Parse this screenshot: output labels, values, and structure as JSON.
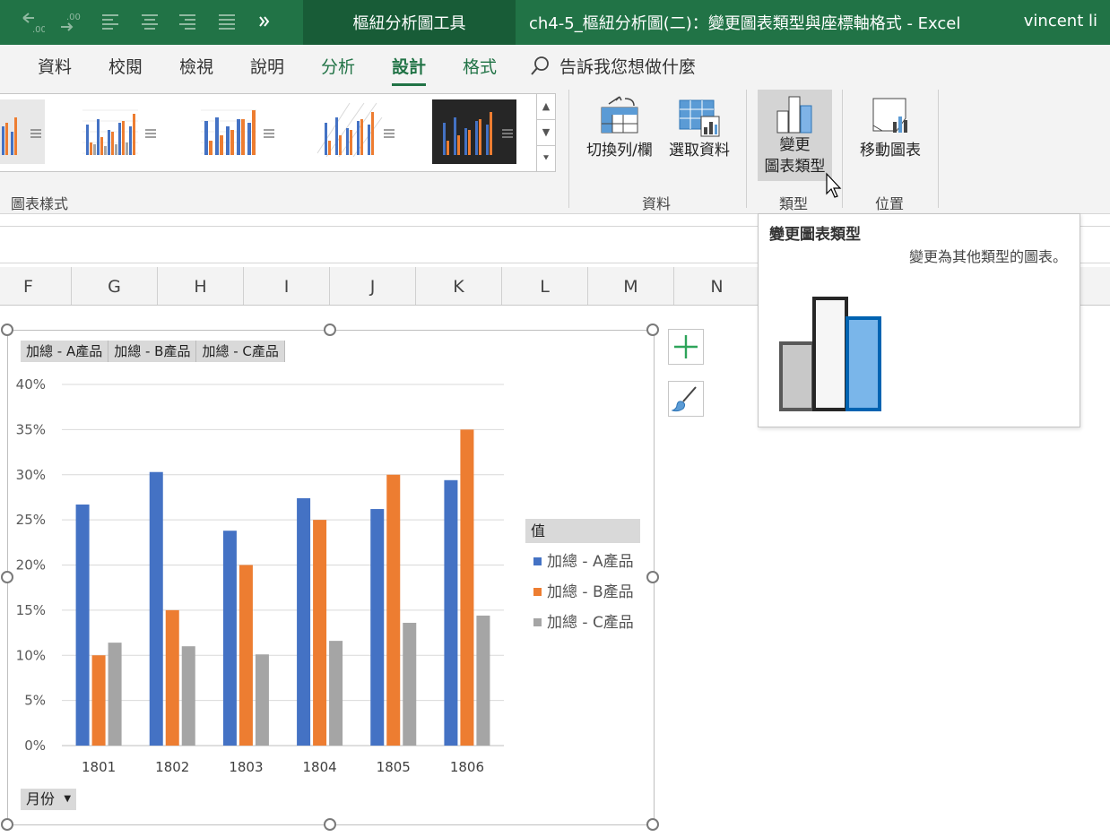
{
  "titlebar": {
    "qat_icons": [
      "undo-icon",
      "redo-icon",
      "align-left-icon",
      "align-center-icon",
      "align-right-icon",
      "justify-icon",
      "more-icon"
    ],
    "context_tab": "樞紐分析圖工具",
    "document_title": "ch4-5_樞紐分析圖(二)：變更圖表類型與座標軸格式  -  Excel",
    "user": "vincent li"
  },
  "ribbon_tabs": {
    "partial": "：",
    "data": "資料",
    "review": "校閱",
    "view": "檢視",
    "help": "說明",
    "analyze": "分析",
    "design": "設計",
    "format": "格式",
    "tell_me": "告訴我您想做什麼"
  },
  "ribbon": {
    "chart_styles_label": "圖表樣式",
    "switch_row_col": "切換列/欄",
    "select_data": "選取資料",
    "data_group_label": "資料",
    "change_type_line1": "變更",
    "change_type_line2": "圖表類型",
    "type_group_label": "類型",
    "move_chart": "移動圖表",
    "location_group_label": "位置"
  },
  "columns": [
    "F",
    "G",
    "H",
    "I",
    "J",
    "K",
    "L",
    "M",
    "N"
  ],
  "tooltip": {
    "title": "變更圖表類型",
    "description": "變更為其他類型的圖表。"
  },
  "chart": {
    "field_buttons": [
      "加總 - A產品",
      "加總 - B產品",
      "加總 - C產品"
    ],
    "legend_title": "值",
    "axis_field_button": "月份"
  },
  "colors": {
    "excel_green": "#217346",
    "series_a": "#4472c4",
    "series_b": "#ed7d31",
    "series_c": "#a5a5a5"
  },
  "chart_data": {
    "type": "bar",
    "categories": [
      "1801",
      "1802",
      "1803",
      "1804",
      "1805",
      "1806"
    ],
    "series": [
      {
        "name": "加總 - A產品",
        "values": [
          0.267,
          0.303,
          0.238,
          0.274,
          0.262,
          0.294
        ]
      },
      {
        "name": "加總 - B產品",
        "values": [
          0.1,
          0.15,
          0.2,
          0.25,
          0.3,
          0.35
        ]
      },
      {
        "name": "加總 - C產品",
        "values": [
          0.114,
          0.11,
          0.101,
          0.116,
          0.136,
          0.144
        ]
      }
    ],
    "ylim": [
      0,
      0.4
    ],
    "yticks": [
      "0%",
      "5%",
      "10%",
      "15%",
      "20%",
      "25%",
      "30%",
      "35%",
      "40%"
    ],
    "grid": true,
    "legend_position": "right"
  }
}
